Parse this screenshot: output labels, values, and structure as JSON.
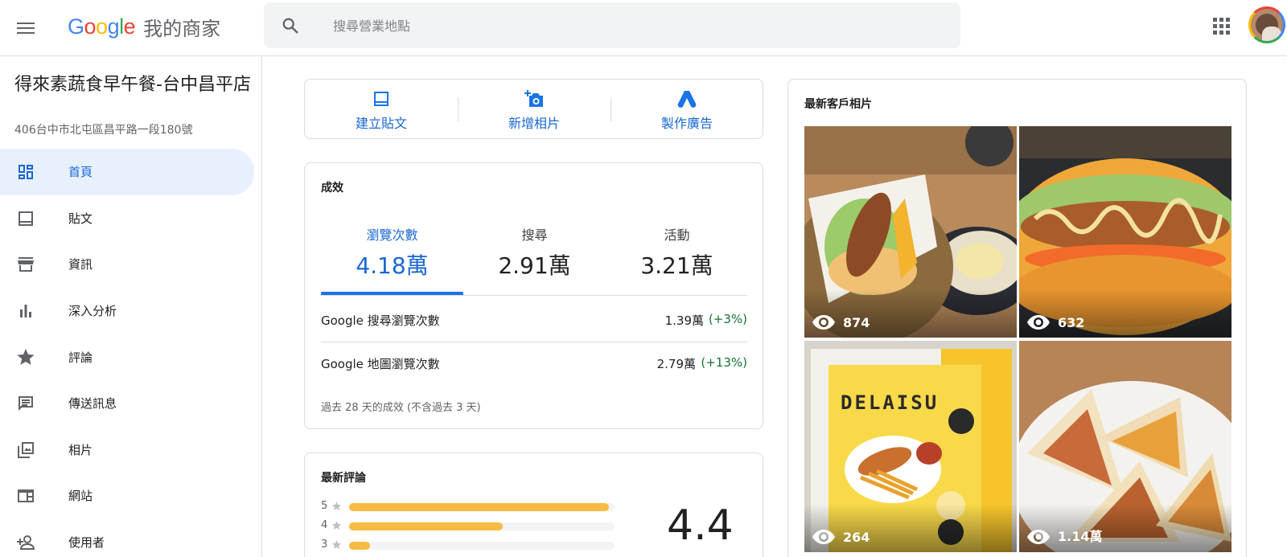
{
  "header": {
    "logo_google": "Google",
    "logo_suffix": "我的商家",
    "search_placeholder": "搜尋營業地點"
  },
  "sidebar": {
    "business_name": "得來素蔬食早午餐-台中昌平店",
    "business_address": "406台中市北屯區昌平路一段180號",
    "items": [
      {
        "label": "首頁",
        "icon": "dashboard-icon",
        "active": true
      },
      {
        "label": "貼文",
        "icon": "post-icon"
      },
      {
        "label": "資訊",
        "icon": "store-icon"
      },
      {
        "label": "深入分析",
        "icon": "bar-chart-icon"
      },
      {
        "label": "評論",
        "icon": "star-icon"
      },
      {
        "label": "傳送訊息",
        "icon": "message-icon"
      },
      {
        "label": "相片",
        "icon": "photo-library-icon"
      },
      {
        "label": "網站",
        "icon": "web-icon"
      },
      {
        "label": "使用者",
        "icon": "person-add-icon"
      }
    ]
  },
  "actions": {
    "create_post": "建立貼文",
    "add_photo": "新增相片",
    "create_ad": "製作廣告"
  },
  "performance": {
    "title": "成效",
    "tabs": [
      {
        "label": "瀏覽次數",
        "value": "4.18萬",
        "active": true
      },
      {
        "label": "搜尋",
        "value": "2.91萬"
      },
      {
        "label": "活動",
        "value": "3.21萬"
      }
    ],
    "rows": [
      {
        "label": "Google 搜尋瀏覽次數",
        "value": "1.39萬",
        "change": "(+3%)"
      },
      {
        "label": "Google 地圖瀏覽次數",
        "value": "2.79萬",
        "change": "(+13%)"
      }
    ],
    "note": "過去 28 天的成效 (不含過去 3 天)"
  },
  "reviews": {
    "title": "最新評論",
    "average": "4.4",
    "distribution": [
      {
        "stars": "5",
        "fraction": 0.98
      },
      {
        "stars": "4",
        "fraction": 0.58
      },
      {
        "stars": "3",
        "fraction": 0.08
      }
    ]
  },
  "photos": {
    "title": "最新客戶相片",
    "items": [
      {
        "views": "874"
      },
      {
        "views": "632"
      },
      {
        "views": "264"
      },
      {
        "views": "1.14萬"
      }
    ]
  },
  "colors": {
    "accent": "#1a73e8",
    "accent_text": "#1967d2",
    "positive": "#137333",
    "rating_bar": "#f6bb42"
  }
}
